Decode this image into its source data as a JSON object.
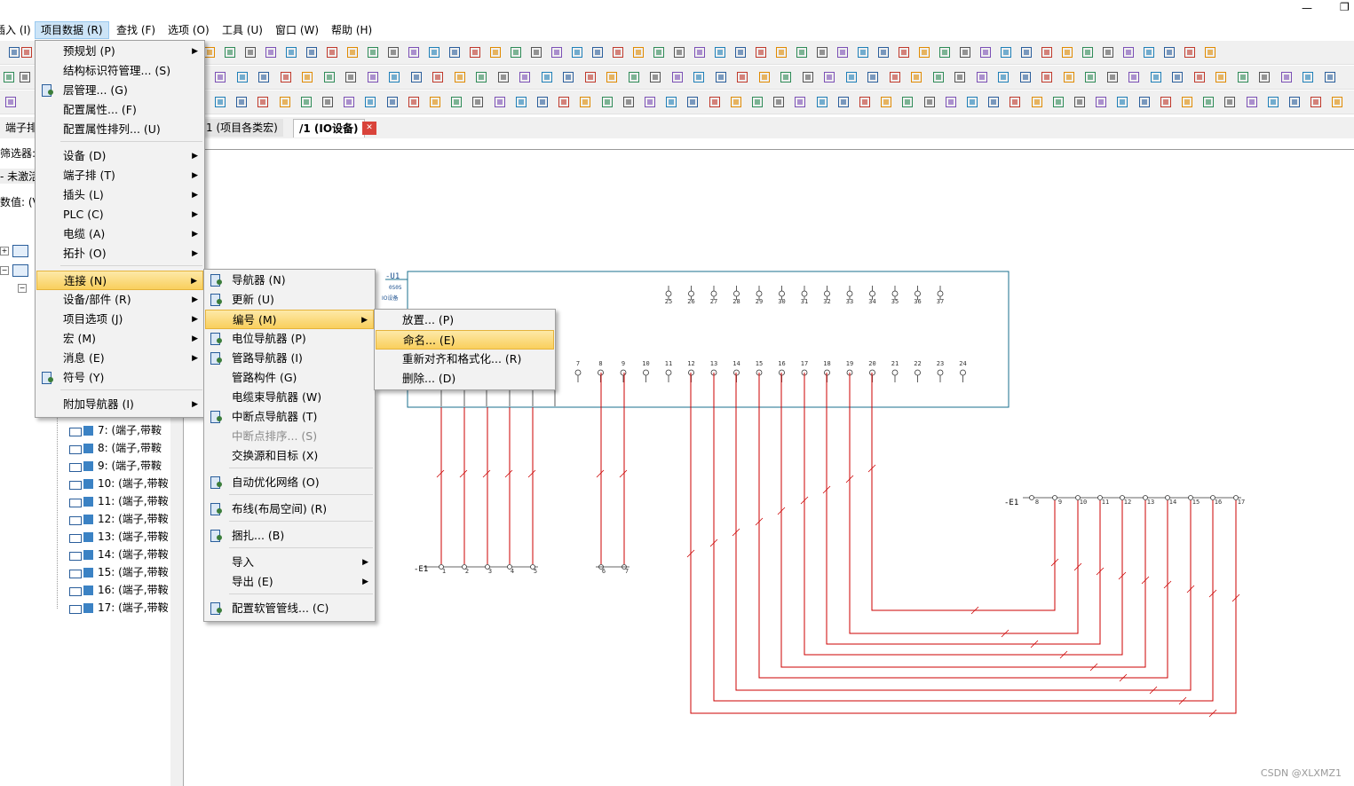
{
  "menubar": {
    "items": [
      "插入 (I)",
      "项目数据 (R)",
      "查找 (F)",
      "选项 (O)",
      "工具 (U)",
      "窗口 (W)",
      "帮助 (H)"
    ]
  },
  "window_controls": {
    "minimize": "—",
    "restore": "❐"
  },
  "tabs": [
    {
      "label": "1 (项目各类宏)"
    },
    {
      "label": "/1 (IO设备)"
    }
  ],
  "tab_close": "✕",
  "left_panel": {
    "header": "端子排 -",
    "filter_label": "筛选器: (",
    "filter_value": "- 未激活",
    "value_label": "数值: (V)",
    "tree_rows": [
      "7: (端子,带鞍",
      "8: (端子,带鞍",
      "9: (端子,带鞍",
      "10: (端子,带鞍",
      "11: (端子,带鞍",
      "12: (端子,带鞍",
      "13: (端子,带鞍",
      "14: (端子,带鞍",
      "15: (端子,带鞍",
      "16: (端子,带鞍",
      "17: (端子,带鞍"
    ]
  },
  "menu_project_data": {
    "items": [
      {
        "label": "预规划 (P)",
        "arrow": true
      },
      {
        "label": "结构标识符管理... (S)"
      },
      {
        "label": "层管理... (G)",
        "icon": "layers-icon"
      },
      {
        "label": "配置属性... (F)"
      },
      {
        "label": "配置属性排列... (U)"
      },
      {
        "label": "设备 (D)",
        "arrow": true
      },
      {
        "label": "端子排 (T)",
        "arrow": true
      },
      {
        "label": "插头 (L)",
        "arrow": true
      },
      {
        "label": "PLC (C)",
        "arrow": true
      },
      {
        "label": "电缆 (A)",
        "arrow": true
      },
      {
        "label": "拓扑 (O)",
        "arrow": true
      },
      {
        "label": "连接 (N)",
        "arrow": true,
        "highlight": true
      },
      {
        "label": "设备/部件 (R)",
        "arrow": true
      },
      {
        "label": "项目选项 (J)",
        "arrow": true
      },
      {
        "label": "宏 (M)",
        "arrow": true
      },
      {
        "label": "消息 (E)",
        "arrow": true
      },
      {
        "label": "符号 (Y)",
        "icon": "symbol-icon"
      },
      {
        "label": "附加导航器 (I)",
        "arrow": true
      }
    ]
  },
  "menu_connection": {
    "items": [
      {
        "label": "导航器 (N)",
        "icon": "navigator-icon"
      },
      {
        "label": "更新 (U)",
        "icon": "update-icon"
      },
      {
        "label": "编号 (M)",
        "arrow": true,
        "highlight": true
      },
      {
        "label": "电位导航器 (P)",
        "icon": "potential-navigator-icon"
      },
      {
        "label": "管路导航器 (I)",
        "icon": "pipe-navigator-icon"
      },
      {
        "label": "管路构件 (G)"
      },
      {
        "label": "电缆束导航器 (W)"
      },
      {
        "label": "中断点导航器 (T)",
        "icon": "interruption-navigator-icon"
      },
      {
        "label": "中断点排序... (S)",
        "disabled": true
      },
      {
        "label": "交换源和目标 (X)"
      },
      {
        "label": "自动优化网络 (O)",
        "icon": "optimize-network-icon"
      },
      {
        "label": "布线(布局空间) (R)",
        "icon": "routing-icon"
      },
      {
        "label": "捆扎... (B)",
        "icon": "bundle-icon"
      },
      {
        "label": "导入",
        "arrow": true
      },
      {
        "label": "导出 (E)",
        "arrow": true
      },
      {
        "label": "配置软管管线... (C)",
        "icon": "hose-icon"
      }
    ]
  },
  "menu_numbering": {
    "items": [
      {
        "label": "放置... (P)"
      },
      {
        "label": "命名... (E)",
        "highlight": true
      },
      {
        "label": "重新对齐和格式化... (R)"
      },
      {
        "label": "删除... (D)"
      }
    ]
  },
  "schematic": {
    "device_label": "-U1",
    "device_sub1": "0S0S",
    "device_sub2": "IO设备",
    "top_pins": [
      "25",
      "26",
      "27",
      "28",
      "29",
      "30",
      "31",
      "32",
      "33",
      "34",
      "35",
      "36",
      "37"
    ],
    "mid_pins": [
      "7",
      "8",
      "9",
      "10",
      "11",
      "12",
      "13",
      "14",
      "15",
      "16",
      "17",
      "18",
      "19",
      "20",
      "21",
      "22",
      "23",
      "24"
    ],
    "left_strip_label": "-E1",
    "left_strip_pins": [
      "1",
      "2",
      "3",
      "4",
      "5"
    ],
    "left_strip_pins2": [
      "6",
      "7"
    ],
    "right_strip_label": "-E1",
    "right_strip_pins": [
      "8",
      "9",
      "10",
      "11",
      "12",
      "13",
      "14",
      "15",
      "16",
      "17"
    ],
    "wire_color": "#cc0000",
    "device_color": "#1a6f8e"
  },
  "watermark": "CSDN @XLXMZ1",
  "colors": {
    "menu_highlight": "#f9cf5c",
    "menubar_active": "#cce4f7"
  }
}
